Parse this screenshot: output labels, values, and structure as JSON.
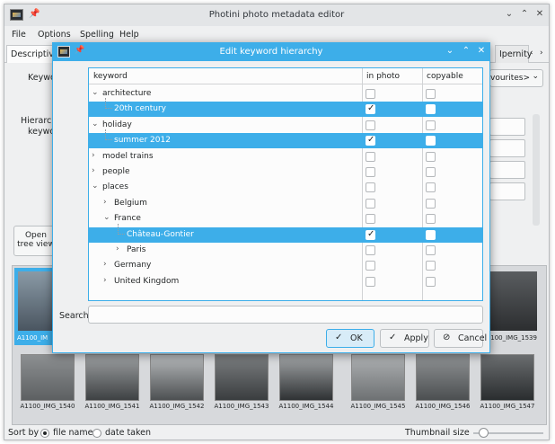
{
  "main": {
    "title": "Photini photo metadata editor",
    "menu": [
      "File",
      "Options",
      "Spelling",
      "Help"
    ],
    "tabs": {
      "first": "Descriptive",
      "last": "Ipernity"
    },
    "bg_labels": {
      "keywords": "Keywo",
      "hierarchical_1": "Hierarchi",
      "hierarchical_2": "keywo",
      "favourites": "vourites>",
      "open_1": "Open",
      "open_2": "tree view"
    },
    "thumbnails": [
      {
        "caption": "A1100_IMG_1540"
      },
      {
        "caption": "A1100_IMG_1541"
      },
      {
        "caption": "A1100_IMG_1542"
      },
      {
        "caption": "A1100_IMG_1543"
      },
      {
        "caption": "A1100_IMG_1544"
      },
      {
        "caption": "A1100_IMG_1545"
      },
      {
        "caption": "A1100_IMG_1546"
      },
      {
        "caption": "A1100_IMG_1547"
      }
    ],
    "top_captions": {
      "first": "A1100_IM",
      "last": "A1100_IMG_1539"
    },
    "status": {
      "sort_by": "Sort by",
      "file_name": "file name",
      "date_taken": "date taken",
      "thumbnail_size": "Thumbnail size"
    }
  },
  "dialog": {
    "title": "Edit keyword hierarchy",
    "columns": {
      "keyword": "keyword",
      "in_photo": "in photo",
      "copyable": "copyable"
    },
    "rows": [
      {
        "label": "architecture",
        "expanded": true,
        "arrow": "v",
        "in_photo": false,
        "copyable": false,
        "selected": false
      },
      {
        "label": "20th century",
        "arrow": "",
        "in_photo": true,
        "copyable": false,
        "selected": true
      },
      {
        "label": "holiday",
        "arrow": "v",
        "in_photo": false,
        "copyable": false,
        "selected": false
      },
      {
        "label": "summer 2012",
        "arrow": "",
        "in_photo": true,
        "copyable": false,
        "selected": true
      },
      {
        "label": "model trains",
        "arrow": ">",
        "in_photo": false,
        "copyable": false,
        "selected": false
      },
      {
        "label": "people",
        "arrow": ">",
        "in_photo": false,
        "copyable": false,
        "selected": false
      },
      {
        "label": "places",
        "arrow": "v",
        "in_photo": false,
        "copyable": false,
        "selected": false
      },
      {
        "label": "Belgium",
        "arrow": ">",
        "in_photo": false,
        "copyable": false,
        "selected": false
      },
      {
        "label": "France",
        "arrow": "v",
        "in_photo": false,
        "copyable": false,
        "selected": false
      },
      {
        "label": "Château-Gontier",
        "arrow": "",
        "in_photo": true,
        "copyable": false,
        "selected": true
      },
      {
        "label": "Paris",
        "arrow": ">",
        "in_photo": false,
        "copyable": false,
        "selected": false
      },
      {
        "label": "Germany",
        "arrow": ">",
        "in_photo": false,
        "copyable": false,
        "selected": false
      },
      {
        "label": "United Kingdom",
        "arrow": ">",
        "in_photo": false,
        "copyable": false,
        "selected": false
      }
    ],
    "search_label": "Search",
    "search_value": "",
    "buttons": {
      "ok": "OK",
      "apply": "Apply",
      "cancel": "Cancel"
    }
  },
  "colors": {
    "accent": "#3daee9",
    "window": "#eff0f1"
  }
}
